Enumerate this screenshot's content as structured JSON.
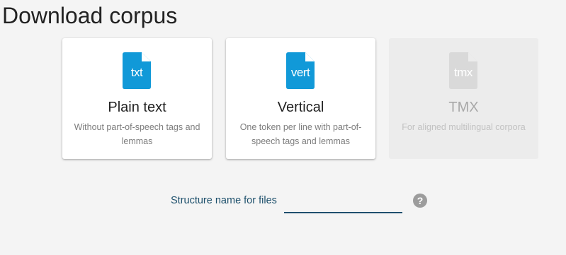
{
  "page": {
    "title": "Download corpus"
  },
  "formats": [
    {
      "extension": "txt",
      "title": "Plain text",
      "description": "Without part-of-speech tags and lemmas",
      "enabled": true,
      "icon": "file-txt-icon",
      "icon_color": "#1199d8"
    },
    {
      "extension": "vert",
      "title": "Vertical",
      "description": "One token per line with part-of-speech tags and lemmas",
      "enabled": true,
      "icon": "file-vert-icon",
      "icon_color": "#1199d8"
    },
    {
      "extension": "tmx",
      "title": "TMX",
      "description": "For aligned multilingual corpora",
      "enabled": false,
      "icon": "file-tmx-icon",
      "icon_color": "#d9d9d9"
    }
  ],
  "structure_field": {
    "label": "Structure name for files",
    "value": "",
    "help_icon": "question-mark-icon",
    "help_glyph": "?"
  },
  "colors": {
    "accent": "#1199d8",
    "label": "#1c4f6b",
    "disabled": "#d9d9d9"
  }
}
